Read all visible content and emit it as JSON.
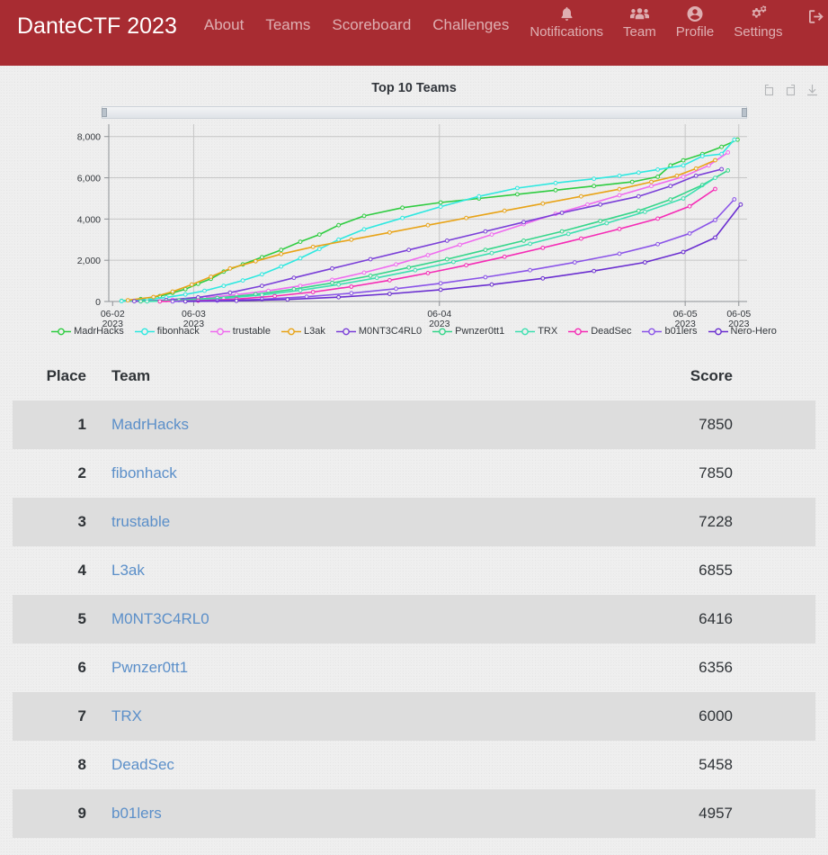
{
  "navbar": {
    "brand": "DanteCTF 2023",
    "links": [
      {
        "label": "About",
        "name": "nav-link-about"
      },
      {
        "label": "Teams",
        "name": "nav-link-teams"
      },
      {
        "label": "Scoreboard",
        "name": "nav-link-scoreboard"
      },
      {
        "label": "Challenges",
        "name": "nav-link-challenges"
      }
    ],
    "icon_items": [
      {
        "label": "Notifications",
        "icon": "bell-icon"
      },
      {
        "label": "Team",
        "icon": "users-icon"
      },
      {
        "label": "Profile",
        "icon": "user-circle-icon"
      },
      {
        "label": "Settings",
        "icon": "gears-icon"
      }
    ],
    "logout": {
      "label": "",
      "icon": "logout-icon"
    },
    "brand_bg": "#a82c32",
    "link_color": "#e6c2c4"
  },
  "chart_toolbar": {
    "buttons": [
      {
        "name": "reset-zoom-button",
        "icon": "restore-icon"
      },
      {
        "name": "undo-zoom-button",
        "icon": "undo-icon"
      },
      {
        "name": "download-button",
        "icon": "download-icon"
      }
    ]
  },
  "chart_data": {
    "type": "line",
    "title": "Top 10 Teams",
    "xlabel": "",
    "ylabel": "",
    "ylim": [
      0,
      8600
    ],
    "yticks": [
      0,
      2000,
      4000,
      6000,
      8000
    ],
    "ytick_labels": [
      "0",
      "2,000",
      "4,000",
      "6,000",
      "8,000"
    ],
    "xticks": [
      "06-02\n2023",
      "06-03\n2023",
      "06-04\n2023",
      "06-05\n2023",
      "06-05\n2023"
    ],
    "xtick_labels": [
      {
        "date": "06-02",
        "year": "2023"
      },
      {
        "date": "06-03",
        "year": "2023"
      },
      {
        "date": "06-04",
        "year": "2023"
      },
      {
        "date": "06-05",
        "year": "2023"
      },
      {
        "date": "06-05",
        "year": "2023"
      }
    ],
    "grid": true,
    "legend_position": "bottom",
    "series": [
      {
        "name": "MadrHacks",
        "color": "#2ecc40",
        "x": [
          0.02,
          0.05,
          0.08,
          0.1,
          0.12,
          0.14,
          0.16,
          0.18,
          0.21,
          0.24,
          0.27,
          0.3,
          0.33,
          0.36,
          0.4,
          0.46,
          0.52,
          0.58,
          0.64,
          0.7,
          0.76,
          0.82,
          0.86,
          0.88,
          0.9,
          0.93,
          0.96,
          0.985
        ],
        "y": [
          30,
          120,
          260,
          420,
          600,
          860,
          1100,
          1450,
          1800,
          2150,
          2500,
          2900,
          3250,
          3700,
          4150,
          4550,
          4800,
          5000,
          5200,
          5400,
          5600,
          5800,
          6050,
          6600,
          6850,
          7150,
          7500,
          7850
        ]
      },
      {
        "name": "fibonhack",
        "color": "#2ee8e0",
        "x": [
          0.02,
          0.06,
          0.09,
          0.12,
          0.15,
          0.18,
          0.21,
          0.24,
          0.27,
          0.3,
          0.33,
          0.36,
          0.4,
          0.46,
          0.52,
          0.58,
          0.64,
          0.7,
          0.76,
          0.8,
          0.83,
          0.86,
          0.9,
          0.93,
          0.96,
          0.98
        ],
        "y": [
          20,
          90,
          200,
          340,
          520,
          760,
          1020,
          1320,
          1700,
          2100,
          2550,
          3000,
          3500,
          4050,
          4600,
          5100,
          5500,
          5750,
          5950,
          6100,
          6250,
          6400,
          6600,
          7050,
          7150,
          7850
        ]
      },
      {
        "name": "trustable",
        "color": "#ef6bef",
        "x": [
          0.05,
          0.1,
          0.15,
          0.2,
          0.25,
          0.3,
          0.35,
          0.4,
          0.45,
          0.5,
          0.55,
          0.6,
          0.65,
          0.7,
          0.75,
          0.8,
          0.85,
          0.9,
          0.94,
          0.97
        ],
        "y": [
          10,
          80,
          180,
          330,
          520,
          760,
          1050,
          1400,
          1800,
          2250,
          2750,
          3250,
          3750,
          4250,
          4700,
          5150,
          5600,
          6050,
          6600,
          7228
        ]
      },
      {
        "name": "L3ak",
        "color": "#e8a317",
        "x": [
          0.03,
          0.07,
          0.1,
          0.13,
          0.16,
          0.19,
          0.23,
          0.27,
          0.32,
          0.38,
          0.44,
          0.5,
          0.56,
          0.62,
          0.68,
          0.74,
          0.8,
          0.85,
          0.89,
          0.92,
          0.95
        ],
        "y": [
          60,
          220,
          480,
          820,
          1200,
          1600,
          1950,
          2300,
          2650,
          3000,
          3350,
          3700,
          4050,
          4400,
          4750,
          5100,
          5450,
          5800,
          6100,
          6450,
          6855
        ]
      },
      {
        "name": "M0NT3C4RL0",
        "color": "#7a3fd8",
        "x": [
          0.04,
          0.09,
          0.14,
          0.19,
          0.24,
          0.29,
          0.35,
          0.41,
          0.47,
          0.53,
          0.59,
          0.65,
          0.71,
          0.77,
          0.83,
          0.88,
          0.92,
          0.96
        ],
        "y": [
          15,
          70,
          200,
          430,
          760,
          1150,
          1600,
          2050,
          2500,
          2950,
          3400,
          3850,
          4300,
          4700,
          5100,
          5600,
          6100,
          6416
        ]
      },
      {
        "name": "Pwnzer0tt1",
        "color": "#35d68a",
        "x": [
          0.05,
          0.11,
          0.17,
          0.23,
          0.29,
          0.35,
          0.41,
          0.47,
          0.53,
          0.59,
          0.65,
          0.71,
          0.77,
          0.83,
          0.88,
          0.93,
          0.97
        ],
        "y": [
          10,
          60,
          170,
          350,
          600,
          900,
          1250,
          1650,
          2050,
          2500,
          2950,
          3400,
          3900,
          4400,
          4950,
          5650,
          6356
        ]
      },
      {
        "name": "TRX",
        "color": "#3ddfb0",
        "x": [
          0.06,
          0.12,
          0.18,
          0.24,
          0.3,
          0.36,
          0.42,
          0.48,
          0.54,
          0.6,
          0.66,
          0.72,
          0.78,
          0.84,
          0.9,
          0.95
        ],
        "y": [
          5,
          50,
          150,
          320,
          540,
          820,
          1150,
          1520,
          1920,
          2350,
          2800,
          3280,
          3800,
          4350,
          5000,
          6000
        ]
      },
      {
        "name": "DeadSec",
        "color": "#f52bb5",
        "x": [
          0.08,
          0.14,
          0.2,
          0.26,
          0.32,
          0.38,
          0.44,
          0.5,
          0.56,
          0.62,
          0.68,
          0.74,
          0.8,
          0.86,
          0.91,
          0.95
        ],
        "y": [
          5,
          40,
          120,
          260,
          460,
          720,
          1030,
          1380,
          1760,
          2170,
          2600,
          3050,
          3520,
          4020,
          4620,
          5458
        ]
      },
      {
        "name": "b01lers",
        "color": "#8a53e8",
        "x": [
          0.1,
          0.17,
          0.24,
          0.31,
          0.38,
          0.45,
          0.52,
          0.59,
          0.66,
          0.73,
          0.8,
          0.86,
          0.91,
          0.95,
          0.98
        ],
        "y": [
          5,
          40,
          110,
          230,
          400,
          620,
          880,
          1180,
          1520,
          1900,
          2320,
          2780,
          3300,
          3950,
          4957
        ]
      },
      {
        "name": "Nero-Hero",
        "color": "#6a2ed0",
        "x": [
          0.12,
          0.2,
          0.28,
          0.36,
          0.44,
          0.52,
          0.6,
          0.68,
          0.76,
          0.84,
          0.9,
          0.95,
          0.99
        ],
        "y": [
          5,
          35,
          100,
          210,
          370,
          570,
          820,
          1120,
          1480,
          1900,
          2400,
          3100,
          4700
        ]
      }
    ]
  },
  "table": {
    "headers": {
      "place": "Place",
      "team": "Team",
      "score": "Score"
    },
    "rows": [
      {
        "place": "1",
        "team": "MadrHacks",
        "score": "7850"
      },
      {
        "place": "2",
        "team": "fibonhack",
        "score": "7850"
      },
      {
        "place": "3",
        "team": "trustable",
        "score": "7228"
      },
      {
        "place": "4",
        "team": "L3ak",
        "score": "6855"
      },
      {
        "place": "5",
        "team": "M0NT3C4RL0",
        "score": "6416"
      },
      {
        "place": "6",
        "team": "Pwnzer0tt1",
        "score": "6356"
      },
      {
        "place": "7",
        "team": "TRX",
        "score": "6000"
      },
      {
        "place": "8",
        "team": "DeadSec",
        "score": "5458"
      },
      {
        "place": "9",
        "team": "b01lers",
        "score": "4957"
      }
    ]
  }
}
